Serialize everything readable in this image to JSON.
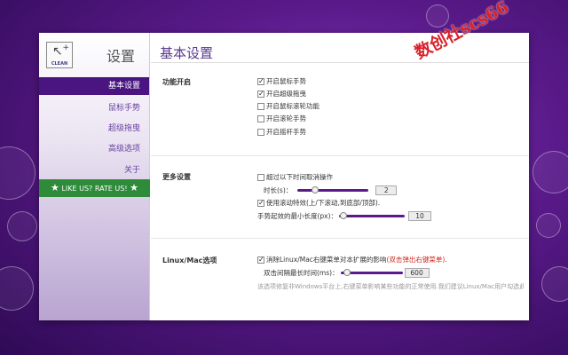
{
  "sidebar": {
    "title": "设置",
    "logo_text": "CLEAN",
    "items": [
      {
        "label": "基本设置",
        "active": true
      },
      {
        "label": "鼠标手势",
        "active": false
      },
      {
        "label": "超级拖曳",
        "active": false
      },
      {
        "label": "高级选项",
        "active": false
      },
      {
        "label": "关于",
        "active": false
      }
    ],
    "rate_label": "LIKE US? RATE US!"
  },
  "main": {
    "title": "基本设置",
    "features": {
      "label": "功能开启",
      "options": [
        {
          "label": "开启鼠标手势",
          "checked": true
        },
        {
          "label": "开启超级拖曳",
          "checked": true
        },
        {
          "label": "开启鼠标滚轮功能",
          "checked": false
        },
        {
          "label": "开启滚轮手势",
          "checked": false
        },
        {
          "label": "开启摇杆手势",
          "checked": false
        }
      ]
    },
    "more": {
      "label": "更多设置",
      "timeout_check": {
        "label": "超过以下时间取消操作",
        "checked": false
      },
      "duration": {
        "label": "时长(s)：",
        "value": "2",
        "fraction": 0.25
      },
      "scroll_check": {
        "label": "使用滚动特效(上/下滚动,到底部/顶部).",
        "checked": true
      },
      "min_length": {
        "label": "手势起效的最小长度(px)：",
        "value": "10",
        "fraction": 0.06
      }
    },
    "linux": {
      "label": "Linux/Mac选项",
      "remove_check": {
        "label": "消除Linux/Mac右键菜单对本扩展的影响",
        "highlight": "(双击弹出右键菜单)",
        "tail": ".",
        "checked": true
      },
      "interval": {
        "label": "双击间隔最长时间(ms)：",
        "value": "600",
        "fraction": 0.1
      },
      "hint": "该选项修复非Windows平台上,右键菜单影响某些功能的正常使用.我们建议Linux/Mac用户勾选此项"
    }
  },
  "watermark": "数创社scs66"
}
